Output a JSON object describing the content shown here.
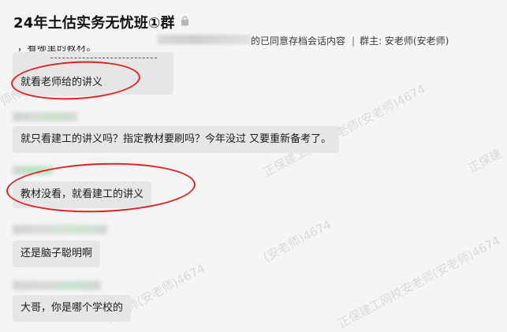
{
  "header": {
    "title": "24年土估实务无忧班①群",
    "subtitle_consent": "的已同意存档会话内容",
    "subtitle_separator": "|",
    "subtitle_owner": "群主: 安老师(安老师)"
  },
  "top_partial_text": "，看哪里的教材。",
  "messages": [
    {
      "text": "就看老师给的讲义"
    },
    {
      "text": "就只看建工的讲义吗？指定教材要刷吗？今年没过 又要重新备考了。"
    },
    {
      "text": "教材没看，就看建工的讲义"
    },
    {
      "text": "还是脑子聪明啊"
    },
    {
      "text": "大哥，你是哪个学校的"
    }
  ],
  "watermark_text": "正保建工网校安老师(安老师)4674",
  "watermark_partial_1": "师(安老师)4674",
  "watermark_partial_2": "安老师(安老师)4674",
  "watermark_partial_3": "正保建",
  "watermark_partial_4": "(安老师)4674",
  "colors": {
    "annotation_circle": "#e02020",
    "bubble": "#e6e6e6",
    "background": "#f5f5f5"
  }
}
